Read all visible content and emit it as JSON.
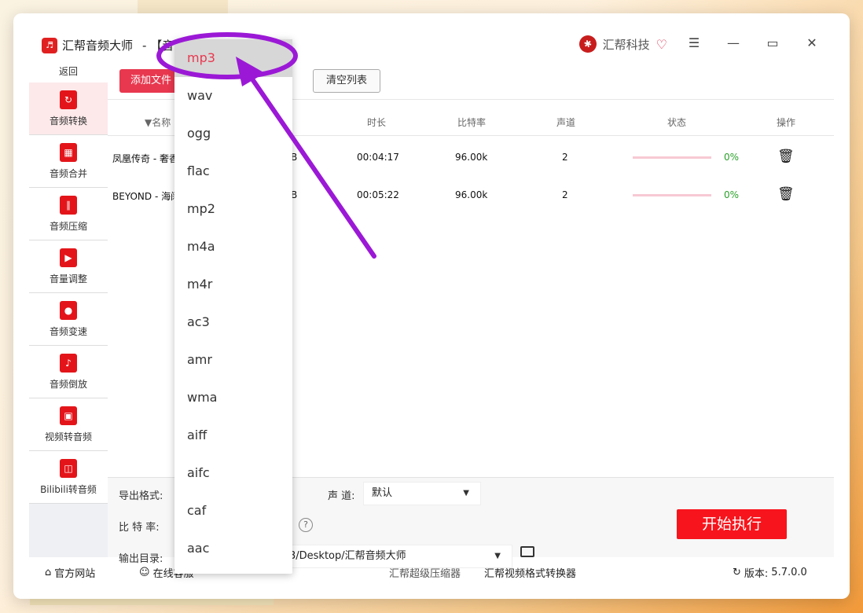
{
  "title": {
    "app_name": "汇帮音频大师",
    "suffix": "- 【音"
  },
  "brand": {
    "name": "汇帮科技"
  },
  "sidebar": {
    "back": "返回",
    "items": [
      {
        "label": "音频转换",
        "icon": "audio-convert-icon",
        "active": true
      },
      {
        "label": "音频合并",
        "icon": "audio-merge-icon"
      },
      {
        "label": "音频压缩",
        "icon": "audio-compress-icon"
      },
      {
        "label": "音量调整",
        "icon": "volume-icon"
      },
      {
        "label": "音频变速",
        "icon": "mic-icon"
      },
      {
        "label": "音频倒放",
        "icon": "music-note-icon"
      },
      {
        "label": "视频转音频",
        "icon": "film-icon"
      },
      {
        "label": "Bilibili转音频",
        "icon": "tv-icon"
      }
    ]
  },
  "toolbar": {
    "add_label": "添加文件",
    "clear_label": "清空列表"
  },
  "table": {
    "headers": [
      "▼名称",
      "时长",
      "比特率",
      "声道",
      "状态",
      "操作"
    ],
    "rows": [
      {
        "name": "凤凰传奇 - 奢香",
        "size_tail": "B",
        "duration": "00:04:17",
        "bitrate": "96.00k",
        "channels": "2",
        "progress": "0%"
      },
      {
        "name": "BEYOND - 海阔",
        "size_tail": "B",
        "duration": "00:05:22",
        "bitrate": "96.00k",
        "channels": "2",
        "progress": "0%"
      }
    ]
  },
  "settings": {
    "format_label": "导出格式:",
    "channel_label": "声 道:",
    "channel_value": "默认",
    "bitrate_label": "比 特 率:",
    "output_label": "输出目录:",
    "output_value": "3/Desktop/汇帮音频大师",
    "start_label": "开始执行"
  },
  "dropdown": {
    "selected": "mp3",
    "options": [
      "mp3",
      "wav",
      "ogg",
      "flac",
      "mp2",
      "m4a",
      "m4r",
      "ac3",
      "amr",
      "wma",
      "aiff",
      "aifc",
      "caf",
      "aac"
    ]
  },
  "footer": {
    "website": "官方网站",
    "online": "在线客服",
    "compressor": "汇帮超级压缩器",
    "video_converter": "汇帮视频格式转换器",
    "version_label": "版本:",
    "version_value": "5.7.0.0"
  },
  "colors": {
    "accent": "#e8384f",
    "start": "#f8141c",
    "annotation": "#9b19d6"
  }
}
